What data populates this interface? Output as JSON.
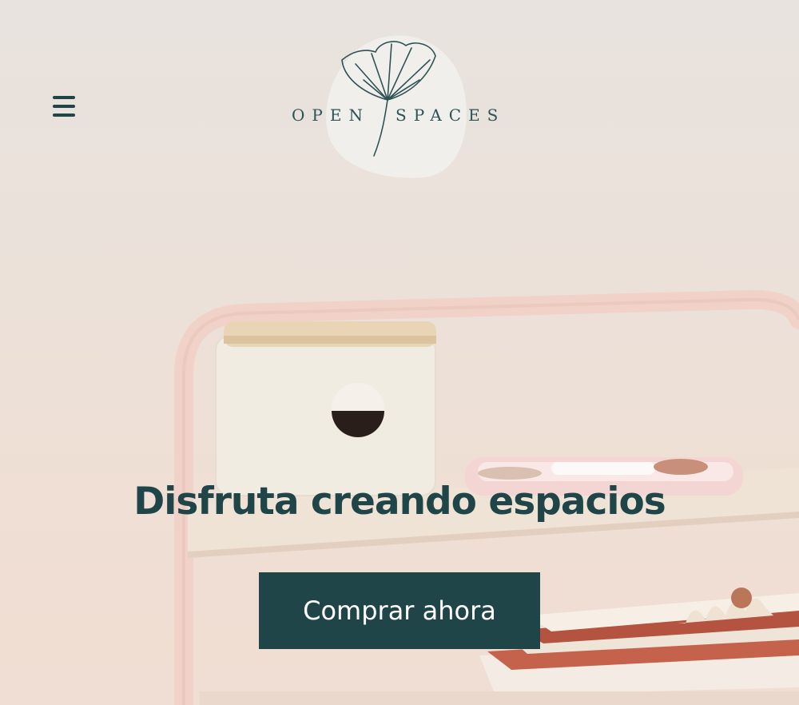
{
  "header": {
    "menu_icon": "hamburger-menu-icon",
    "logo": {
      "word_left": "OPEN",
      "word_right": "SPACES",
      "icon": "ginkgo-leaf-icon"
    }
  },
  "hero": {
    "headline": "Disfruta creando espacios",
    "cta_label": "Comprar ahora"
  },
  "colors": {
    "brand": "#1f4549",
    "button_text": "#ffffff",
    "background": "#e9e3dd"
  }
}
